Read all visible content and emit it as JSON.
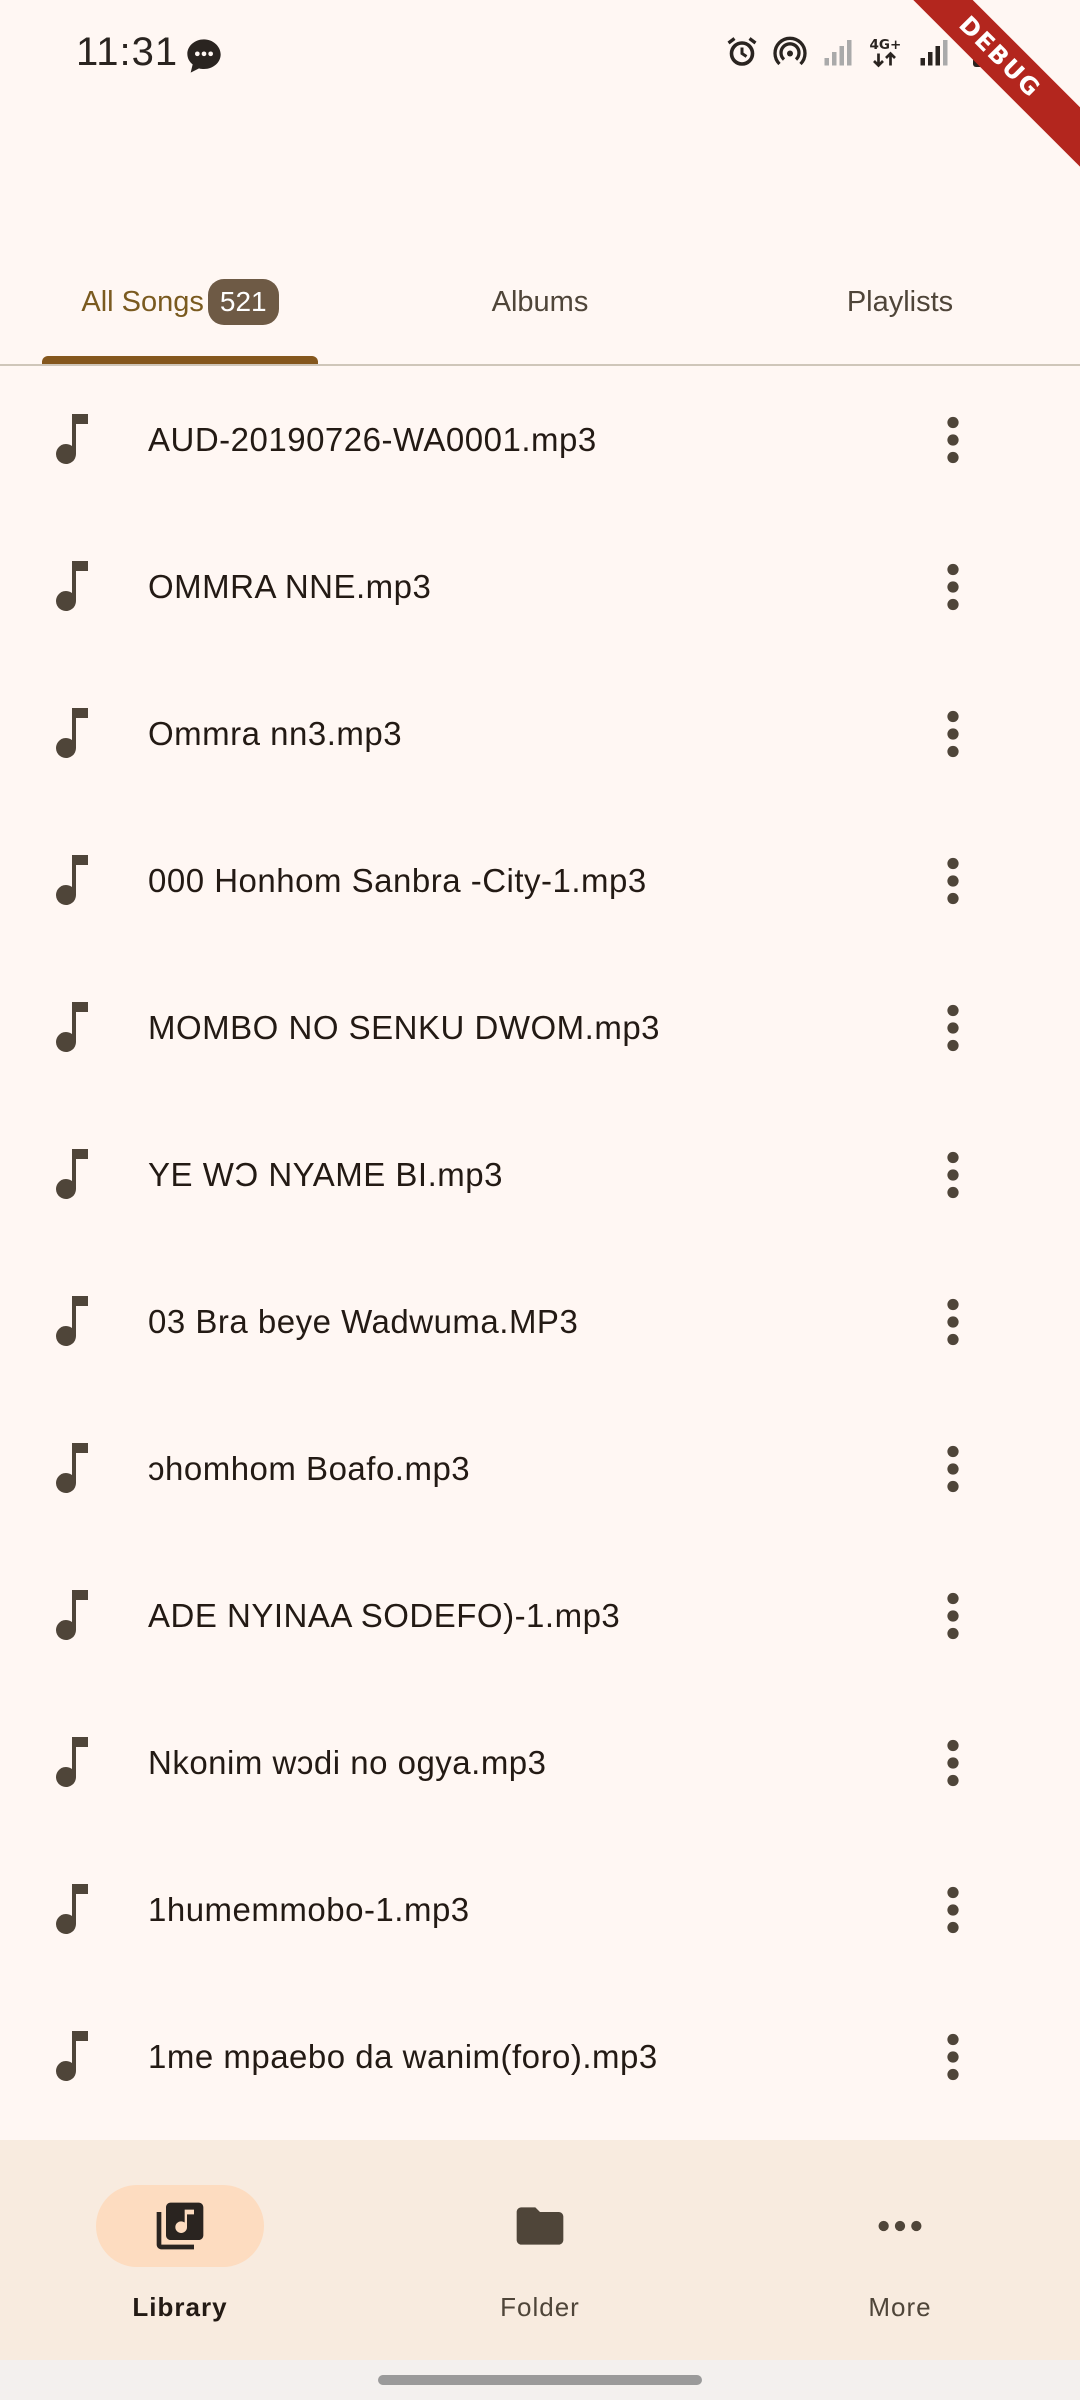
{
  "status_bar": {
    "time": "11:31",
    "debug_label": "DEBUG"
  },
  "tabs": [
    {
      "label": "All Songs",
      "badge": "521",
      "active": true
    },
    {
      "label": "Albums",
      "active": false
    },
    {
      "label": "Playlists",
      "active": false
    }
  ],
  "songs": [
    "AUD-20190726-WA0001.mp3",
    "OMMRA NNE.mp3",
    "Ommra nn3.mp3",
    "000 Honhom Sanbra -City-1.mp3",
    "MOMBO NO SENKU DWOM.mp3",
    "YE WƆ NYAME BI.mp3",
    "03 Bra beye Wadwuma.MP3",
    "ɔhomhom Boafo.mp3",
    "ADE NYINAA SODEFO)-1.mp3",
    "Nkonim wɔdi no ogya.mp3",
    "1humemmobo-1.mp3",
    "1me mpaebo da wanim(foro).mp3"
  ],
  "bottom_nav": [
    {
      "label": "Library",
      "icon": "library-music-icon",
      "active": true
    },
    {
      "label": "Folder",
      "icon": "folder-icon",
      "active": false
    },
    {
      "label": "More",
      "icon": "more-horiz-icon",
      "active": false
    }
  ],
  "colors": {
    "background": "#fff7f3",
    "accent": "#85571d",
    "badge": "#6e5a45",
    "nav_background": "#f8ebdf",
    "nav_pill": "#fddcc0"
  }
}
